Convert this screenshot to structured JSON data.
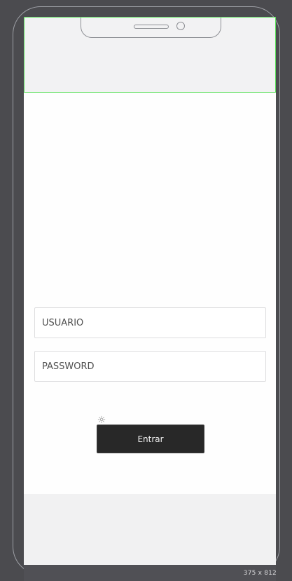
{
  "form": {
    "username_placeholder": "USUARIO",
    "password_placeholder": "PASSWORD",
    "submit_label": "Entrar"
  },
  "device": {
    "size_label": "375 x 812"
  },
  "colors": {
    "background": "#4b4b4f",
    "screen": "#fefefe",
    "header_outline": "#59df59",
    "button": "#282828",
    "button_text": "#f1f1f1"
  },
  "icons": {
    "loader": "sun-icon"
  }
}
